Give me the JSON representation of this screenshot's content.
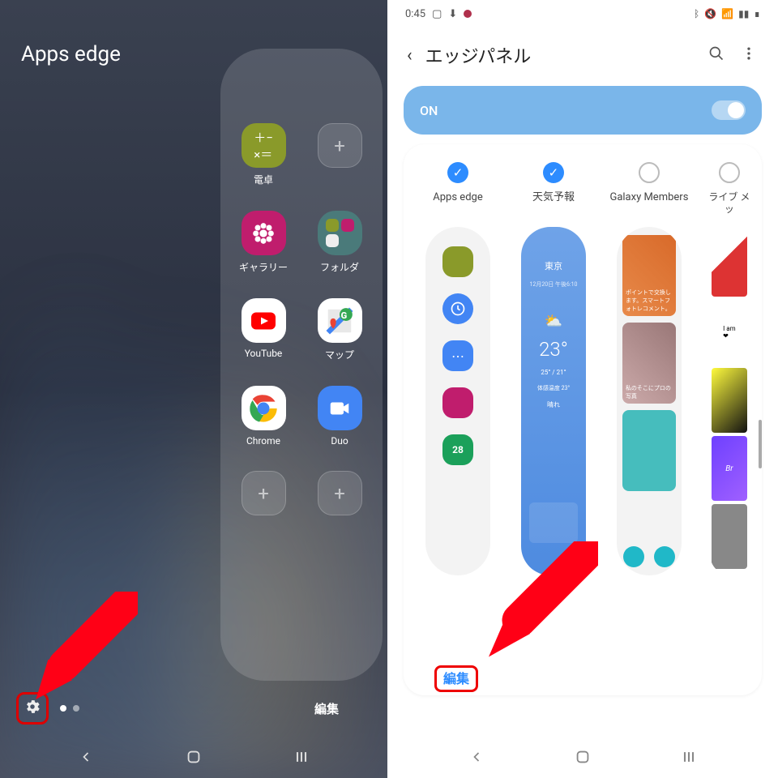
{
  "left": {
    "title": "Apps edge",
    "apps": {
      "calc": "電卓",
      "gallery": "ギャラリー",
      "folder": "フォルダ",
      "youtube": "YouTube",
      "maps": "マップ",
      "chrome": "Chrome",
      "duo": "Duo"
    },
    "edit": "編集"
  },
  "right": {
    "status_time": "0:45",
    "header": "エッジパネル",
    "toggle": "ON",
    "panels": {
      "apps_edge": "Apps edge",
      "weather": "天気予報",
      "galaxy_members": "Galaxy Members",
      "live_msg": "ライブ メッ"
    },
    "weather_data": {
      "city": "東京",
      "date": "12月20日 午後6:10",
      "temp": "23°",
      "range": "25° / 21°",
      "feels": "体感温度 23°",
      "cond": "晴れ"
    },
    "calendar_day": "28",
    "gm_caption1": "ポイントで交換します。スマートフォトレコメント。",
    "gm_caption2": "私のそこにプロの写真",
    "edit": "編集"
  }
}
